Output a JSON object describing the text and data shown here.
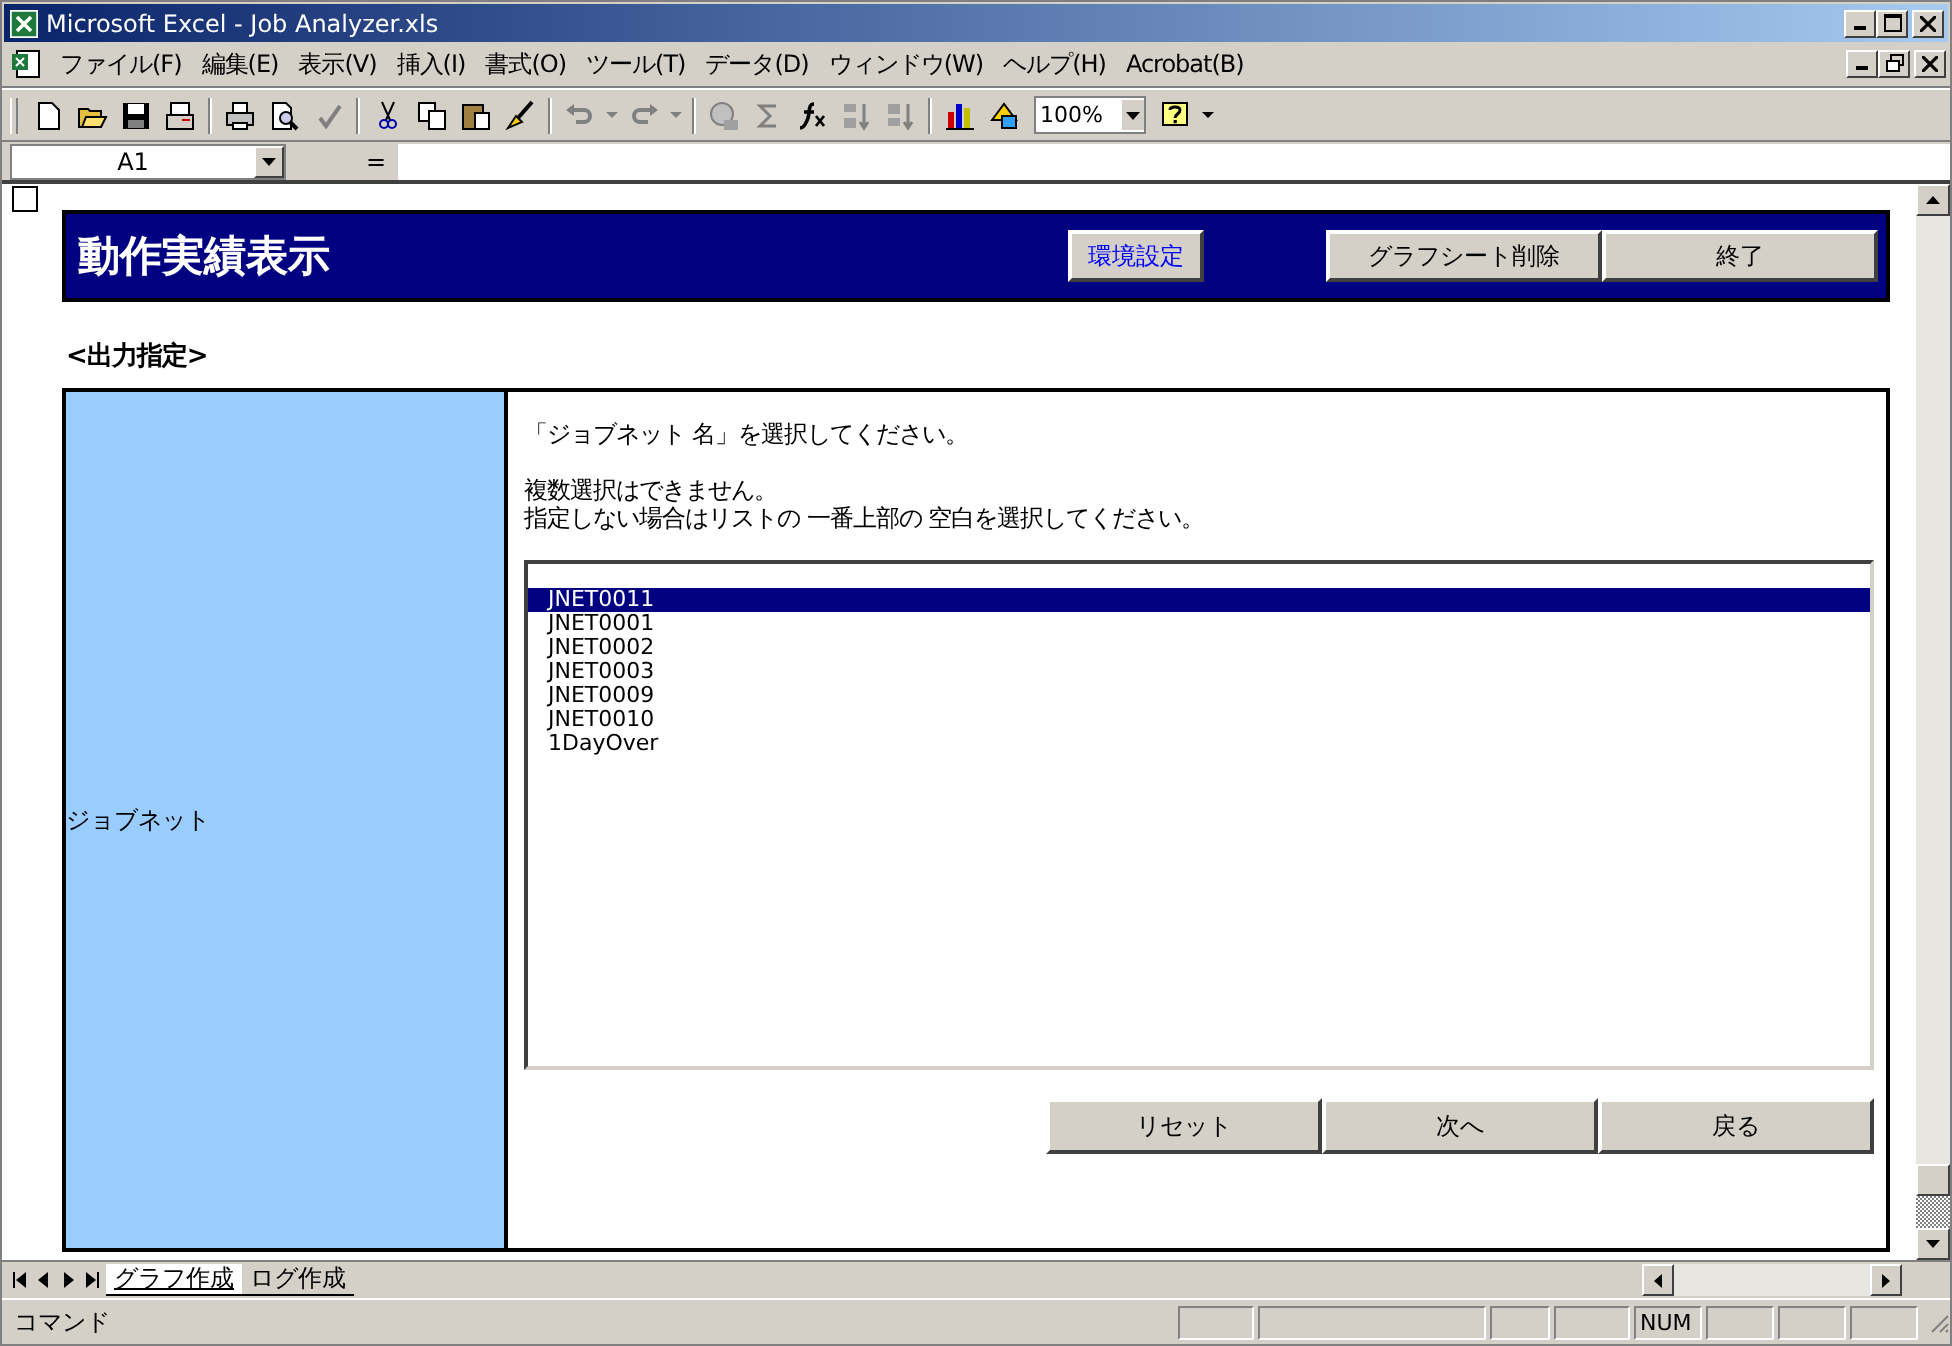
{
  "window": {
    "title": "Microsoft Excel - Job Analyzer.xls"
  },
  "menu": [
    "ファイル(F)",
    "編集(E)",
    "表示(V)",
    "挿入(I)",
    "書式(O)",
    "ツール(T)",
    "データ(D)",
    "ウィンドウ(W)",
    "ヘルプ(H)",
    "Acrobat(B)"
  ],
  "toolbar": {
    "zoom": "100%"
  },
  "formula_bar": {
    "name_box": "A1",
    "equals": "="
  },
  "sheet": {
    "title": "動作実績表示",
    "header_buttons": [
      {
        "label": "環境設定",
        "kind": "link"
      },
      {
        "label": "グラフシート削除",
        "kind": "normal"
      },
      {
        "label": "終了",
        "kind": "normal"
      }
    ],
    "section_label": "<出力指定>",
    "field_label": "ジョブネット",
    "instruction": "「ジョブネット 名」を選択してください。",
    "notes": [
      "複数選択はできません。",
      "指定しない場合はリストの 一番上部の 空白を選択してください。"
    ],
    "list_items": [
      {
        "label": "JNET0011",
        "selected": true
      },
      {
        "label": "JNET0001",
        "selected": false
      },
      {
        "label": "JNET0002",
        "selected": false
      },
      {
        "label": "JNET0003",
        "selected": false
      },
      {
        "label": "JNET0009",
        "selected": false
      },
      {
        "label": "JNET0010",
        "selected": false
      },
      {
        "label": "1DayOver",
        "selected": false
      }
    ],
    "buttons": [
      "リセット",
      "次へ",
      "戻る"
    ]
  },
  "sheet_tabs": [
    {
      "label": "グラフ作成",
      "selected": true
    },
    {
      "label": "ログ作成",
      "selected": false
    }
  ],
  "status_bar": {
    "mode": "コマンド",
    "indicator": "NUM"
  }
}
